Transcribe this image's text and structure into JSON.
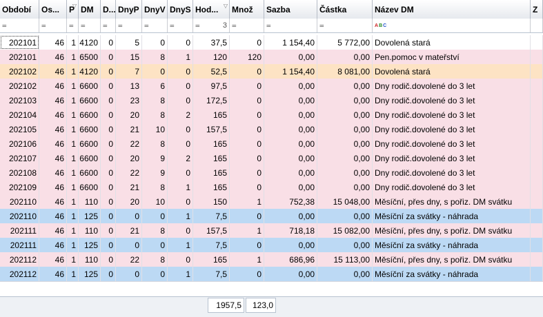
{
  "columns": [
    {
      "key": "obdobi",
      "label": "Období"
    },
    {
      "key": "os",
      "label": "Os..."
    },
    {
      "key": "p",
      "label": "P"
    },
    {
      "key": "dm",
      "label": "DM"
    },
    {
      "key": "d",
      "label": "D..."
    },
    {
      "key": "dnyp",
      "label": "DnyP"
    },
    {
      "key": "dnyv",
      "label": "DnyV"
    },
    {
      "key": "dnys",
      "label": "DnyS"
    },
    {
      "key": "hod",
      "label": "Hod..."
    },
    {
      "key": "mnoz",
      "label": "Množ"
    },
    {
      "key": "sazba",
      "label": "Sazba"
    },
    {
      "key": "castka",
      "label": "Částka"
    },
    {
      "key": "nazev",
      "label": "Název DM"
    },
    {
      "key": "z",
      "label": "Z"
    }
  ],
  "filter_row": {
    "operator": "=",
    "hod_value": "3"
  },
  "rows": [
    {
      "style": "white",
      "selected": true,
      "cells": [
        "202101",
        "46",
        "1",
        "4120",
        "0",
        "5",
        "0",
        "0",
        "37,5",
        "0",
        "1 154,40",
        "5 772,00",
        "Dovolená stará"
      ]
    },
    {
      "style": "pink",
      "cells": [
        "202101",
        "46",
        "1",
        "6500",
        "0",
        "15",
        "8",
        "1",
        "120",
        "120",
        "0,00",
        "0,00",
        "Pen.pomoc v mateřství"
      ]
    },
    {
      "style": "orange",
      "cells": [
        "202102",
        "46",
        "1",
        "4120",
        "0",
        "7",
        "0",
        "0",
        "52,5",
        "0",
        "1 154,40",
        "8 081,00",
        "Dovolená stará"
      ]
    },
    {
      "style": "pink",
      "cells": [
        "202102",
        "46",
        "1",
        "6600",
        "0",
        "13",
        "6",
        "0",
        "97,5",
        "0",
        "0,00",
        "0,00",
        "Dny rodič.dovolené do 3 let"
      ]
    },
    {
      "style": "pink",
      "cells": [
        "202103",
        "46",
        "1",
        "6600",
        "0",
        "23",
        "8",
        "0",
        "172,5",
        "0",
        "0,00",
        "0,00",
        "Dny rodič.dovolené do 3 let"
      ]
    },
    {
      "style": "pink",
      "cells": [
        "202104",
        "46",
        "1",
        "6600",
        "0",
        "20",
        "8",
        "2",
        "165",
        "0",
        "0,00",
        "0,00",
        "Dny rodič.dovolené do 3 let"
      ]
    },
    {
      "style": "pink",
      "cells": [
        "202105",
        "46",
        "1",
        "6600",
        "0",
        "21",
        "10",
        "0",
        "157,5",
        "0",
        "0,00",
        "0,00",
        "Dny rodič.dovolené do 3 let"
      ]
    },
    {
      "style": "pink",
      "cells": [
        "202106",
        "46",
        "1",
        "6600",
        "0",
        "22",
        "8",
        "0",
        "165",
        "0",
        "0,00",
        "0,00",
        "Dny rodič.dovolené do 3 let"
      ]
    },
    {
      "style": "pink",
      "cells": [
        "202107",
        "46",
        "1",
        "6600",
        "0",
        "20",
        "9",
        "2",
        "165",
        "0",
        "0,00",
        "0,00",
        "Dny rodič.dovolené do 3 let"
      ]
    },
    {
      "style": "pink",
      "cells": [
        "202108",
        "46",
        "1",
        "6600",
        "0",
        "22",
        "9",
        "0",
        "165",
        "0",
        "0,00",
        "0,00",
        "Dny rodič.dovolené do 3 let"
      ]
    },
    {
      "style": "pink",
      "cells": [
        "202109",
        "46",
        "1",
        "6600",
        "0",
        "21",
        "8",
        "1",
        "165",
        "0",
        "0,00",
        "0,00",
        "Dny rodič.dovolené do 3 let"
      ]
    },
    {
      "style": "pink",
      "cells": [
        "202110",
        "46",
        "1",
        "110",
        "0",
        "20",
        "10",
        "0",
        "150",
        "1",
        "752,38",
        "15 048,00",
        "Měsíční, přes dny, s pořiz. DM svátku"
      ]
    },
    {
      "style": "blue",
      "cells": [
        "202110",
        "46",
        "1",
        "125",
        "0",
        "0",
        "0",
        "1",
        "7,5",
        "0",
        "0,00",
        "0,00",
        "Měsíční za svátky - náhrada"
      ]
    },
    {
      "style": "pink",
      "cells": [
        "202111",
        "46",
        "1",
        "110",
        "0",
        "21",
        "8",
        "0",
        "157,5",
        "1",
        "718,18",
        "15 082,00",
        "Měsíční, přes dny, s pořiz. DM svátku"
      ]
    },
    {
      "style": "blue",
      "cells": [
        "202111",
        "46",
        "1",
        "125",
        "0",
        "0",
        "0",
        "1",
        "7,5",
        "0",
        "0,00",
        "0,00",
        "Měsíční za svátky - náhrada"
      ]
    },
    {
      "style": "pink",
      "cells": [
        "202112",
        "46",
        "1",
        "110",
        "0",
        "22",
        "8",
        "0",
        "165",
        "1",
        "686,96",
        "15 113,00",
        "Měsíční, přes dny, s pořiz. DM svátku"
      ]
    },
    {
      "style": "blue",
      "cells": [
        "202112",
        "46",
        "1",
        "125",
        "0",
        "0",
        "0",
        "1",
        "7,5",
        "0",
        "0,00",
        "0,00",
        "Měsíční za svátky - náhrada"
      ]
    }
  ],
  "footer": {
    "hod_total": "1957,5",
    "mnoz_total": "123,0"
  }
}
